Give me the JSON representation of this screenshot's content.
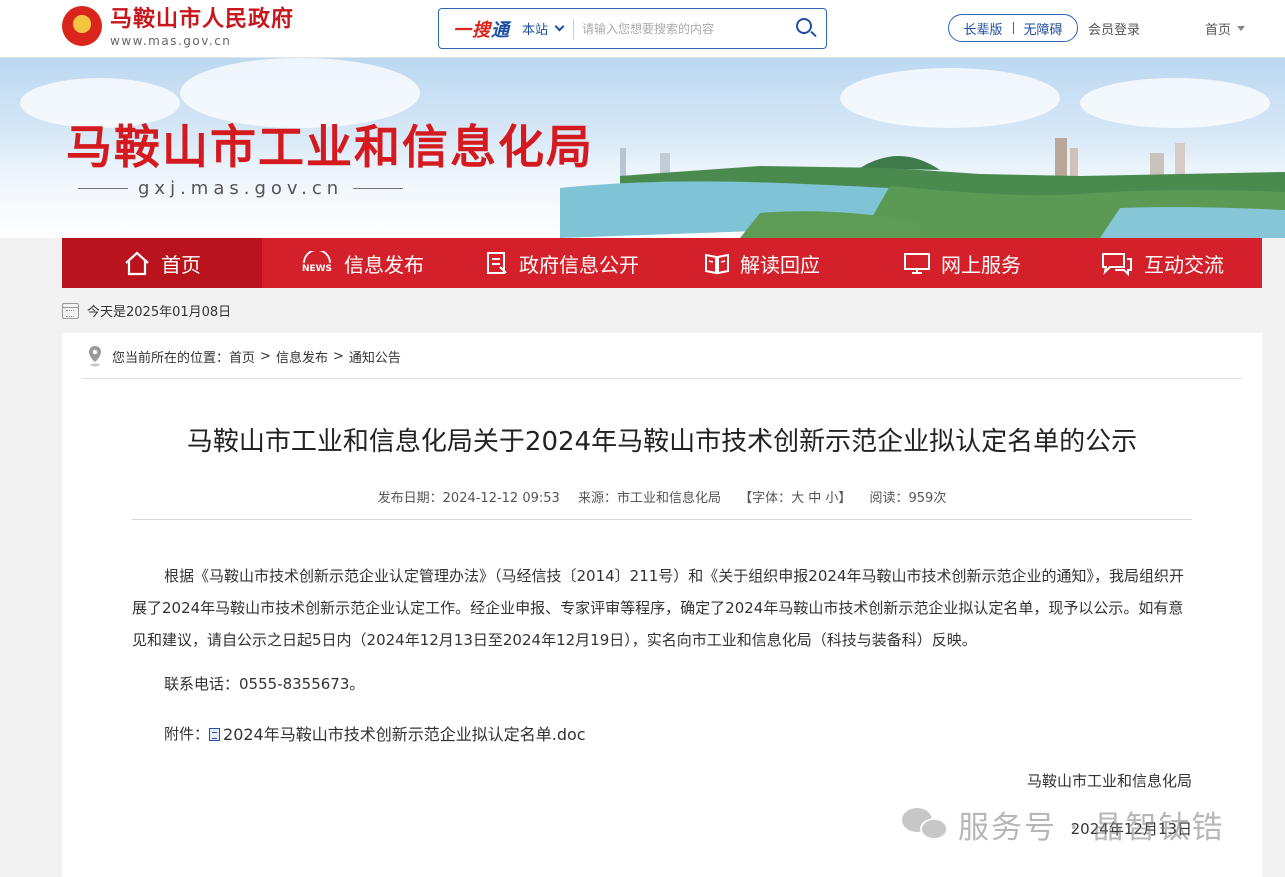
{
  "header": {
    "portal_name": "马鞍山市人民政府",
    "portal_url": "www.mas.gov.cn",
    "search": {
      "brand_part1": "一搜",
      "brand_part2": "通",
      "scope": "本站",
      "placeholder": "请输入您想要搜索的内容"
    },
    "mode_elder": "长辈版",
    "mode_accessible": "无障碍",
    "login": "会员登录",
    "home": "首页"
  },
  "banner": {
    "title": "马鞍山市工业和信息化局",
    "url": "gxj.mas.gov.cn"
  },
  "nav": {
    "items": [
      {
        "label": "首页",
        "icon": "home-icon"
      },
      {
        "label": "信息发布",
        "icon": "news-icon"
      },
      {
        "label": "政府信息公开",
        "icon": "document-icon"
      },
      {
        "label": "解读回应",
        "icon": "book-icon"
      },
      {
        "label": "网上服务",
        "icon": "monitor-icon"
      },
      {
        "label": "互动交流",
        "icon": "chat-icon"
      }
    ]
  },
  "today": "今天是2025年01月08日",
  "breadcrumb": {
    "prefix": "您当前所在的位置：",
    "items": [
      "首页",
      "信息发布",
      "通知公告"
    ],
    "separator": ">"
  },
  "article": {
    "title": "马鞍山市工业和信息化局关于2024年马鞍山市技术创新示范企业拟认定名单的公示",
    "meta": {
      "date_label": "发布日期：2024-12-12 09:53",
      "source_label": "来源：市工业和信息化局",
      "font_label": "【字体：大 中 小】",
      "views_label": "阅读：959次"
    },
    "paragraph": "根据《马鞍山市技术创新示范企业认定管理办法》（马经信技〔2014〕211号）和《关于组织申报2024年马鞍山市技术创新示范企业的通知》，我局组织开展了2024年马鞍山市技术创新示范企业认定工作。经企业申报、专家评审等程序，确定了2024年马鞍山市技术创新示范企业拟认定名单，现予以公示。如有意见和建议，请自公示之日起5日内（2024年12月13日至2024年12月19日），实名向市工业和信息化局（科技与装备科）反映。",
    "contact": "联系电话：0555-8355673。",
    "attachment_label": "附件：",
    "attachment_file": "2024年马鞍山市技术创新示范企业拟认定名单.doc",
    "signature_org": "马鞍山市工业和信息化局",
    "signature_date": "2024年12月13日"
  },
  "watermark": "服务号 · 晶智钛锆",
  "colors": {
    "brand_red": "#d4202a",
    "nav_active": "#b9141d",
    "link_blue": "#1d4fa1"
  }
}
